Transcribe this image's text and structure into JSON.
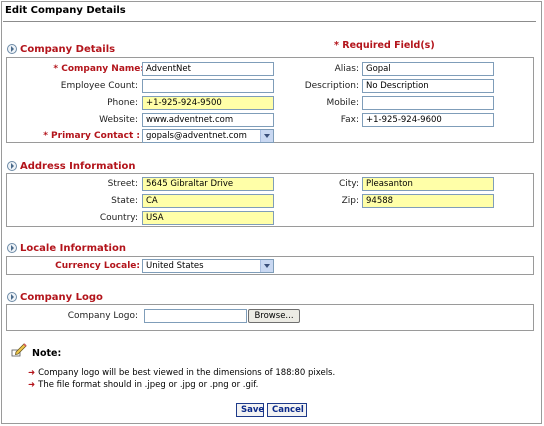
{
  "page_title": "Edit Company Details",
  "required_note": "* Required Field(s)",
  "company": {
    "heading": "Company Details",
    "company_name_label": "* Company Name:",
    "company_name_value": "AdventNet",
    "alias_label": "Alias:",
    "alias_value": "Gopal",
    "employee_count_label": "Employee Count:",
    "employee_count_value": "",
    "description_label": "Description:",
    "description_value": "No Description",
    "phone_label": "Phone:",
    "phone_value": "+1-925-924-9500",
    "mobile_label": "Mobile:",
    "mobile_value": "",
    "website_label": "Website:",
    "website_value": "www.adventnet.com",
    "fax_label": "Fax:",
    "fax_value": "+1-925-924-9600",
    "primary_contact_label": "* Primary Contact :",
    "primary_contact_value": "gopals@adventnet.com"
  },
  "address": {
    "heading": "Address Information",
    "street_label": "Street:",
    "street_value": "5645 Gibraltar Drive",
    "city_label": "City:",
    "city_value": "Pleasanton",
    "state_label": "State:",
    "state_value": "CA",
    "zip_label": "Zip:",
    "zip_value": "94588",
    "country_label": "Country:",
    "country_value": "USA"
  },
  "locale": {
    "heading": "Locale Information",
    "currency_label": "Currency Locale:",
    "currency_value": "United States"
  },
  "logo": {
    "heading": "Company Logo",
    "logo_label": "Company Logo:",
    "logo_value": "",
    "browse_label": "Browse..."
  },
  "note": {
    "title": "Note:",
    "lines": [
      "Company logo will be best viewed in the dimensions of 188:80 pixels.",
      "The file format should in .jpeg or .jpg or .png or .gif."
    ]
  },
  "buttons": {
    "save": "Save",
    "cancel": "Cancel"
  },
  "colors": {
    "required_red": "#b3141b",
    "mandatory_field_fill": "#ffffa8"
  }
}
